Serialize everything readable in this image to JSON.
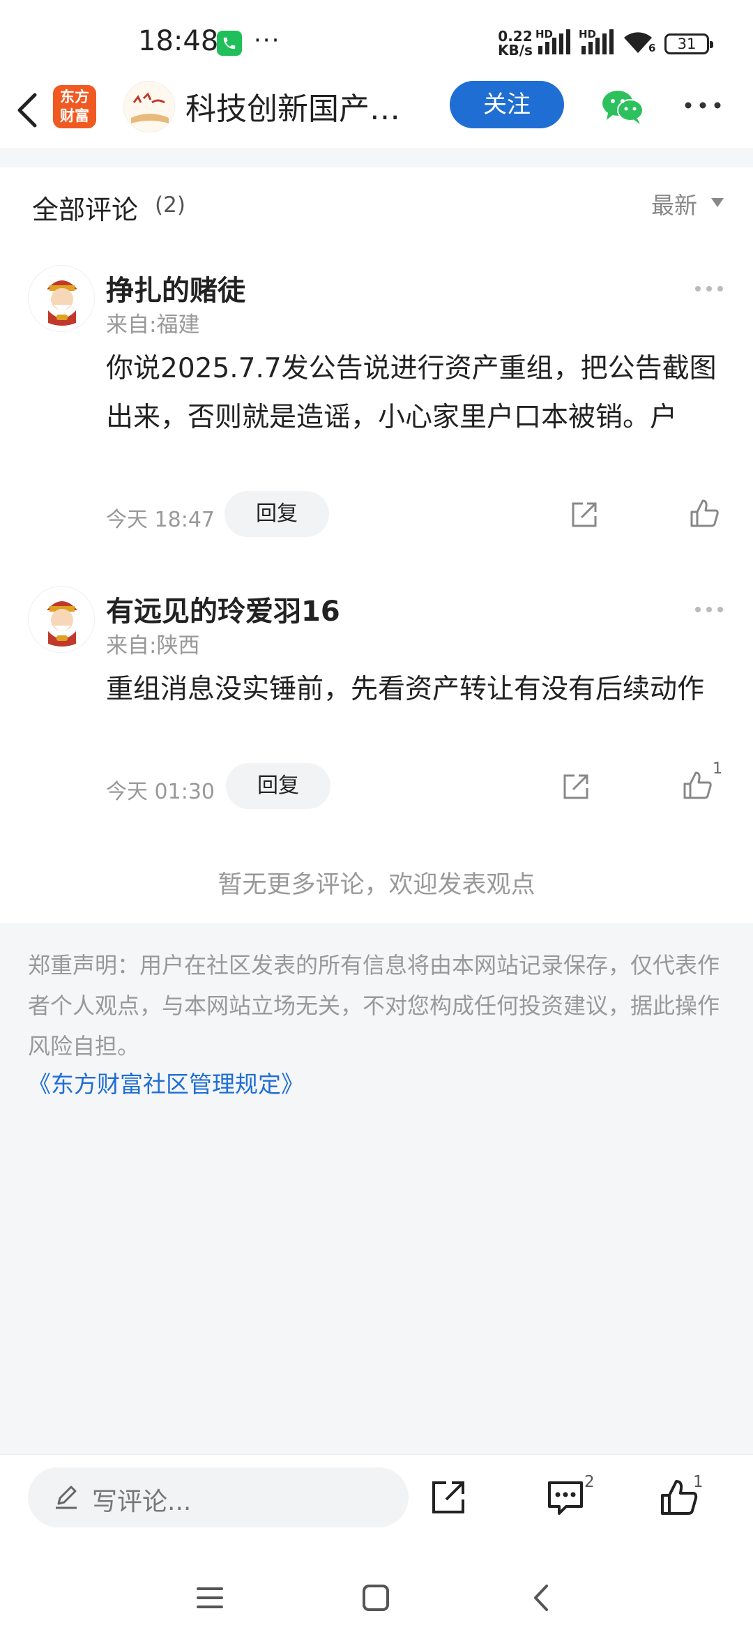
{
  "status_bar": {
    "time": "18:48",
    "speed_value": "0.22",
    "speed_unit": "KB/s",
    "network_label": "HD",
    "battery": "31",
    "wifi_badge": "6"
  },
  "header": {
    "app_logo_line1": "东方",
    "app_logo_line2": "财富",
    "title": "科技创新国产…",
    "follow_label": "关注"
  },
  "comments_section": {
    "title": "全部评论",
    "count": "(2)",
    "sort_label": "最新"
  },
  "comments": [
    {
      "user": "挣扎的赌徒",
      "location": "来自:福建",
      "text": "你说2025.7.7发公告说进行资产重组，把公告截图出来，否则就是造谣，小心家里户口本被销。户",
      "time": "今天 18:47",
      "reply_label": "回复",
      "likes": ""
    },
    {
      "user": "有远见的玲爱羽16",
      "location": "来自:陕西",
      "text": "重组消息没实锤前，先看资产转让有没有后续动作",
      "time": "今天 01:30",
      "reply_label": "回复",
      "likes": "1"
    }
  ],
  "no_more_text": "暂无更多评论，欢迎发表观点",
  "disclaimer": "郑重声明：用户在社区发表的所有信息将由本网站记录保存，仅代表作者个人观点，与本网站立场无关，不对您构成任何投资建议，据此操作风险自担。",
  "rules_link": "《东方财富社区管理规定》",
  "bottom_bar": {
    "input_placeholder": "写评论...",
    "comment_badge": "2",
    "like_badge": "1"
  },
  "colors": {
    "accent": "#1f6ed4",
    "brand": "#f05a22",
    "wechat": "#2dc15d"
  }
}
